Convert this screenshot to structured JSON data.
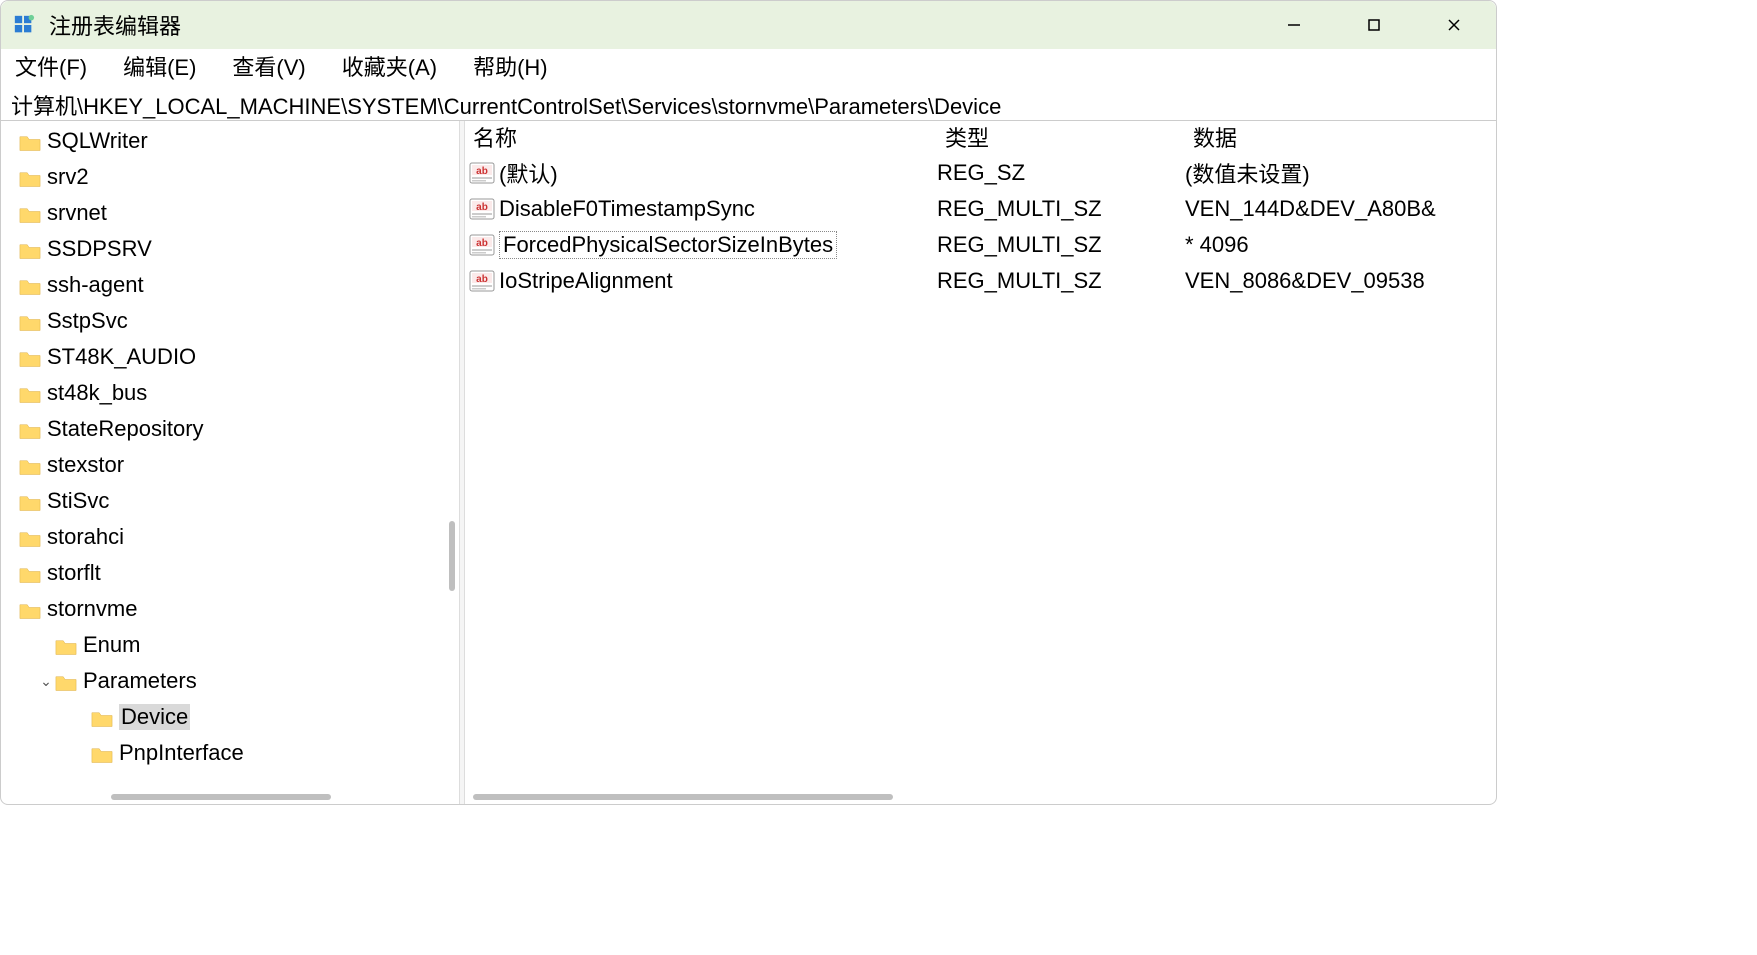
{
  "window": {
    "title": "注册表编辑器"
  },
  "menu": {
    "file": "文件(F)",
    "edit": "编辑(E)",
    "view": "查看(V)",
    "favorites": "收藏夹(A)",
    "help": "帮助(H)"
  },
  "address": "计算机\\HKEY_LOCAL_MACHINE\\SYSTEM\\CurrentControlSet\\Services\\stornvme\\Parameters\\Device",
  "tree": [
    {
      "label": "SQLWriter",
      "indent": 0
    },
    {
      "label": "srv2",
      "indent": 0
    },
    {
      "label": "srvnet",
      "indent": 0
    },
    {
      "label": "SSDPSRV",
      "indent": 0
    },
    {
      "label": "ssh-agent",
      "indent": 0
    },
    {
      "label": "SstpSvc",
      "indent": 0
    },
    {
      "label": "ST48K_AUDIO",
      "indent": 0
    },
    {
      "label": "st48k_bus",
      "indent": 0
    },
    {
      "label": "StateRepository",
      "indent": 0
    },
    {
      "label": "stexstor",
      "indent": 0
    },
    {
      "label": "StiSvc",
      "indent": 0
    },
    {
      "label": "storahci",
      "indent": 0
    },
    {
      "label": "storflt",
      "indent": 0
    },
    {
      "label": "stornvme",
      "indent": 0
    },
    {
      "label": "Enum",
      "indent": 1
    },
    {
      "label": "Parameters",
      "indent": 1,
      "expanded": true
    },
    {
      "label": "Device",
      "indent": 2,
      "selected": true
    },
    {
      "label": "PnpInterface",
      "indent": 2
    }
  ],
  "columns": {
    "name": "名称",
    "type": "类型",
    "data": "数据"
  },
  "values": [
    {
      "name": "(默认)",
      "type": "REG_SZ",
      "data": "(数值未设置)"
    },
    {
      "name": "DisableF0TimestampSync",
      "type": "REG_MULTI_SZ",
      "data": "VEN_144D&DEV_A80B&"
    },
    {
      "name": "ForcedPhysicalSectorSizeInBytes",
      "type": "REG_MULTI_SZ",
      "data": "* 4096",
      "focused": true
    },
    {
      "name": "IoStripeAlignment",
      "type": "REG_MULTI_SZ",
      "data": "VEN_8086&DEV_09538"
    }
  ]
}
